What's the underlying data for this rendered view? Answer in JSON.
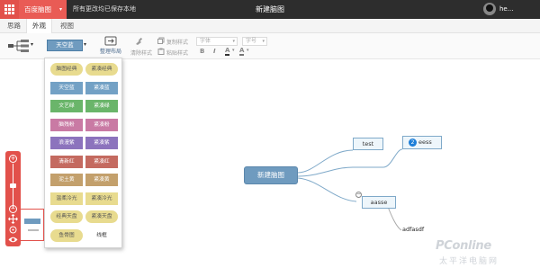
{
  "topbar": {
    "brand_label": "百度脑图",
    "brand_caret": "▾",
    "saved_message": "所有更改均已保存本地",
    "document_title": "新建脑图",
    "user_name": "he..."
  },
  "tabs": [
    {
      "label": "思路",
      "active": false
    },
    {
      "label": "外观",
      "active": true
    },
    {
      "label": "视图",
      "active": false
    }
  ],
  "toolbar": {
    "structure_caret": "▾",
    "theme_label": "天空蓝",
    "theme_caret": "▾",
    "arrange_label": "整理布局",
    "clear_style_label": "清除样式",
    "copy_style_label": "复制样式",
    "paste_style_label": "粘贴样式",
    "font_family_placeholder": "字体",
    "font_size_placeholder": "字号",
    "bold_label": "B",
    "italic_label": "I",
    "font_color_label": "A",
    "bg_color_label": "A"
  },
  "theme_menu": {
    "items": [
      {
        "label": "脑图经典",
        "bg": "#e8db8f",
        "fg": "#555555",
        "pill": true
      },
      {
        "label": "紧凑经典",
        "bg": "#e8db8f",
        "fg": "#555555",
        "pill": true
      },
      {
        "label": "天空蓝",
        "bg": "#73a1c5",
        "fg": "#ffffff",
        "pill": false
      },
      {
        "label": "紧凑蓝",
        "bg": "#73a1c5",
        "fg": "#ffffff",
        "pill": false
      },
      {
        "label": "文艺绿",
        "bg": "#6ab56a",
        "fg": "#ffffff",
        "pill": false
      },
      {
        "label": "紧凑绿",
        "bg": "#6ab56a",
        "fg": "#ffffff",
        "pill": false
      },
      {
        "label": "脑残粉",
        "bg": "#c97aa4",
        "fg": "#ffffff",
        "pill": false
      },
      {
        "label": "紧凑粉",
        "bg": "#c97aa4",
        "fg": "#ffffff",
        "pill": false
      },
      {
        "label": "浪漫紫",
        "bg": "#8c73bd",
        "fg": "#ffffff",
        "pill": false
      },
      {
        "label": "紧凑紫",
        "bg": "#8c73bd",
        "fg": "#ffffff",
        "pill": false
      },
      {
        "label": "清新红",
        "bg": "#c46a60",
        "fg": "#ffffff",
        "pill": false
      },
      {
        "label": "紧凑红",
        "bg": "#c46a60",
        "fg": "#ffffff",
        "pill": false
      },
      {
        "label": "泥土黄",
        "bg": "#c3a06c",
        "fg": "#ffffff",
        "pill": false
      },
      {
        "label": "紧凑黄",
        "bg": "#c3a06c",
        "fg": "#ffffff",
        "pill": false
      },
      {
        "label": "温柔冷光",
        "bg": "#e8db8f",
        "fg": "#555555",
        "pill": false
      },
      {
        "label": "紧凑冷光",
        "bg": "#e8db8f",
        "fg": "#555555",
        "pill": false
      },
      {
        "label": "经典天盘",
        "bg": "#e8db8f",
        "fg": "#555555",
        "pill": true
      },
      {
        "label": "紧凑天盘",
        "bg": "#e8db8f",
        "fg": "#555555",
        "pill": true
      },
      {
        "label": "鱼骨图",
        "bg": "#e8db8f",
        "fg": "#555555",
        "pill": true
      },
      {
        "label": "线框",
        "bg": "#ffffff",
        "fg": "#333333",
        "pill": false
      }
    ]
  },
  "mindmap": {
    "root": "新建脑图",
    "node_test": "test",
    "node_eess_badge": "2",
    "node_eess": "eess",
    "node_aasse": "aasse",
    "leaf_adfasdf": "adfasdf",
    "collapse_symbol": "−"
  },
  "zoombar": {
    "zoom_in": "+",
    "zoom_out": "−"
  },
  "watermark": {
    "line1": "PConline",
    "line2": "太平洋电脑网"
  },
  "colors": {
    "accent_red": "#e2514b",
    "theme_blue": "#6f9bbf",
    "topbar_dark": "#2d2d2d",
    "branch_line": "#7fa9c9"
  }
}
